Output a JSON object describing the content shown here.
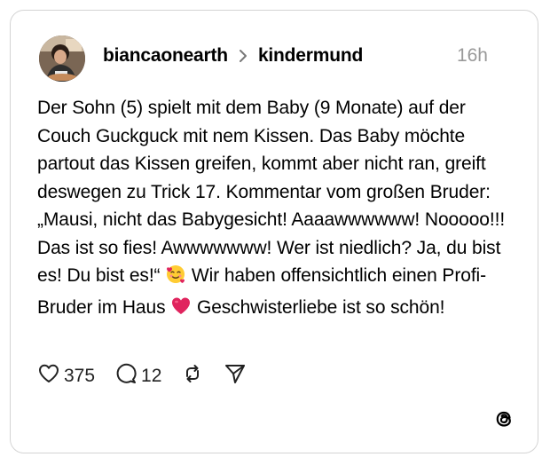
{
  "post": {
    "author": "biancaonearth",
    "community": "kindermund",
    "timestamp": "16h",
    "text_part1": "Der Sohn (5) spielt mit dem Baby (9 Monate) auf der Couch Guckguck mit nem Kissen. Das Baby möchte partout das Kissen greifen, kommt aber nicht ran, greift deswegen zu Trick 17. Kommentar vom großen Bruder: „Mausi, nicht das Babygesicht! Aaaawwwwww! Nooooo!!! Das ist so fies! Awwwwwww! Wer ist niedlich? Ja, du bist es! Du bist es!“ ",
    "text_part2": " Wir haben offensichtlich einen Profi-Bruder im Haus ",
    "text_part3": " Geschwisterliebe ist so schön!",
    "emoji1": "smiling-face-with-hearts-icon",
    "emoji2": "red-heart-icon"
  },
  "actions": {
    "likes": "375",
    "replies": "12"
  },
  "icons": {
    "like": "heart-outline-icon",
    "reply": "speech-bubble-icon",
    "repost": "repost-icon",
    "share": "send-icon",
    "brand": "threads-logo-icon"
  },
  "colors": {
    "timestamp": "#999999",
    "border": "#d4d4d4",
    "heart_emoji": "#e0245e"
  }
}
